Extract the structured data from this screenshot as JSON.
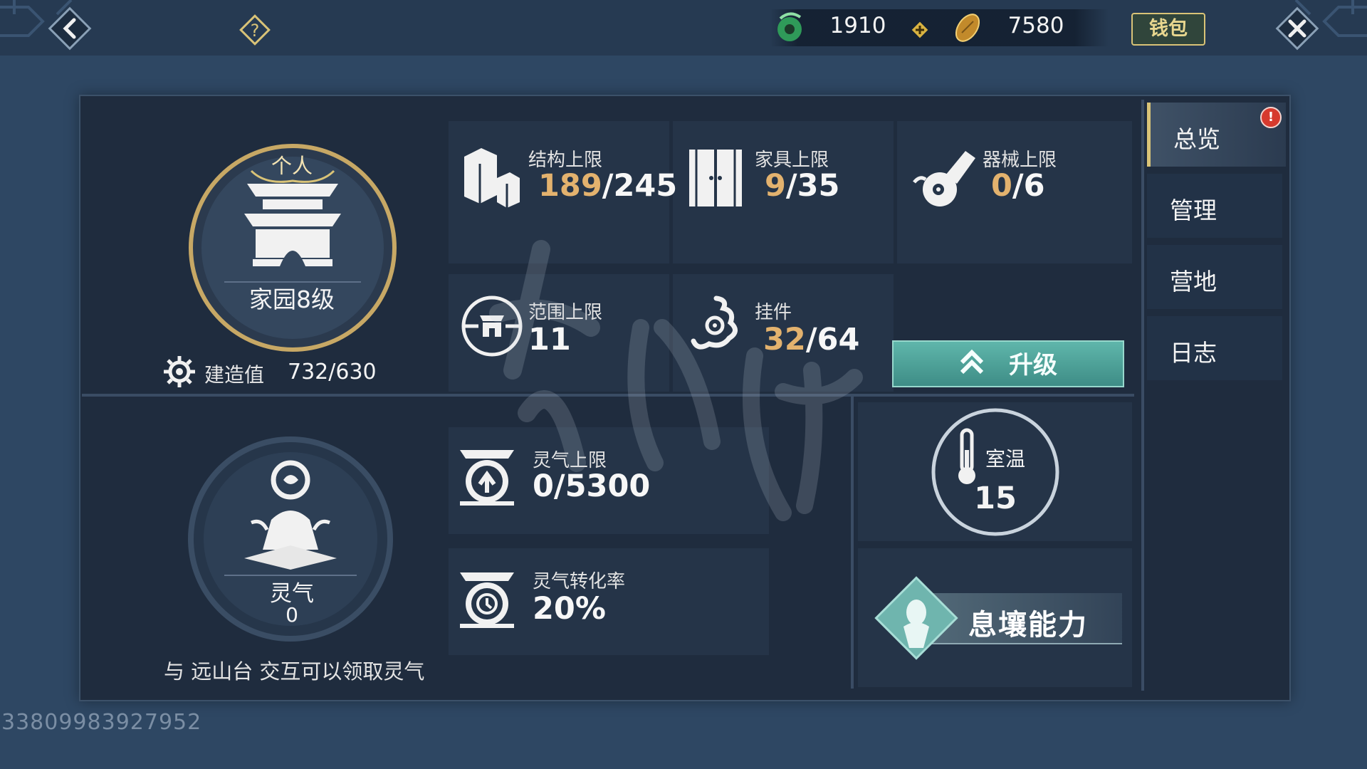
{
  "topbar": {
    "currency": {
      "jade_value": "1910",
      "coin_value": "7580"
    },
    "wallet_label": "钱包"
  },
  "home": {
    "tag": "个人",
    "level": "家园8级",
    "build_label": "建造值",
    "build_value": "732/630"
  },
  "stats": {
    "structure": {
      "label": "结构上限",
      "current": "189",
      "max": "/245"
    },
    "furniture": {
      "label": "家具上限",
      "current": "9",
      "max": "/35"
    },
    "machine": {
      "label": "器械上限",
      "current": "0",
      "max": "/6"
    },
    "range": {
      "label": "范围上限",
      "value": "11"
    },
    "pendant": {
      "label": "挂件",
      "current": "32",
      "max": "/64"
    }
  },
  "upgrade_label": "升级",
  "spirit": {
    "label": "灵气",
    "value": "0",
    "hint": "与 远山台 交互可以领取灵气",
    "cap_label": "灵气上限",
    "cap_value": "0/5300",
    "rate_label": "灵气转化率",
    "rate_value": "20%"
  },
  "temperature": {
    "label": "室温",
    "value": "15"
  },
  "ability_label": "息壤能力",
  "side_tabs": [
    {
      "label": "总览",
      "active": true
    },
    {
      "label": "管理"
    },
    {
      "label": "营地"
    },
    {
      "label": "日志"
    }
  ],
  "alert_badge": "!",
  "uid": "33809983927952",
  "colors": {
    "background": "#2e4763",
    "panel": "#1f2c3e",
    "accent_gold": "#e3b26e",
    "upgrade_teal": "#4fa39a",
    "alert_red": "#d63a2e"
  },
  "icons": {
    "back": "back-arrow-icon",
    "help": "help-icon",
    "close": "close-icon",
    "jade": "jade-currency-icon",
    "coin": "coin-currency-icon",
    "structure": "structure-blocks-icon",
    "furniture": "wardrobe-icon",
    "machine": "machine-gourd-icon",
    "range": "range-pavilion-icon",
    "pendant": "pendant-ornament-icon",
    "spirit_cap": "spirit-cap-icon",
    "spirit_rate": "spirit-rate-icon",
    "thermometer": "thermometer-icon"
  }
}
